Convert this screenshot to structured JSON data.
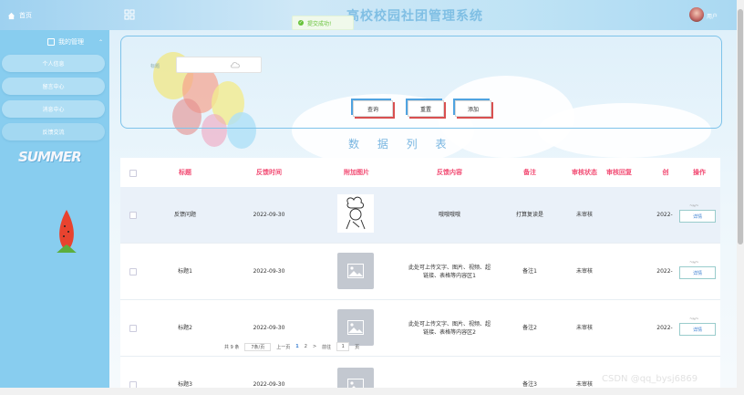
{
  "topbar": {
    "home_label": "首页",
    "title": "高校校园社团管理系统",
    "toast": "提交成功!",
    "user_label": "用户"
  },
  "sidebar": {
    "group_label": "我的管理",
    "items": [
      {
        "label": "个人信息"
      },
      {
        "label": "留言中心"
      },
      {
        "label": "消息中心"
      },
      {
        "label": "反馈交流"
      }
    ],
    "banner_text": "SUMMER"
  },
  "search": {
    "field_label": "标题",
    "field_value": "",
    "buttons": {
      "query": "查询",
      "reset": "重置",
      "add": "添加"
    }
  },
  "section_title": "数 据 列 表",
  "table": {
    "columns": [
      "标题",
      "反馈时间",
      "附加图片",
      "反馈内容",
      "备注",
      "审核状态",
      "审核回复",
      "创",
      "操作"
    ],
    "rows": [
      {
        "title": "反馈问题",
        "time": "2022-09-30",
        "content": "哦哦哦哦",
        "remark": "打算复读是",
        "status": "未审核",
        "created": "2022-",
        "action": "详情"
      },
      {
        "title": "标题1",
        "time": "2022-09-30",
        "content": "此处可上传文字、图片、视频、超链接、表格等内容区1",
        "remark": "备注1",
        "status": "未审核",
        "created": "2022-",
        "action": "详情"
      },
      {
        "title": "标题2",
        "time": "2022-09-30",
        "content": "此处可上传文字、图片、视频、超链接、表格等内容区2",
        "remark": "备注2",
        "status": "未审核",
        "created": "2022-",
        "action": "详情"
      },
      {
        "title": "标题3",
        "time": "2022-09-30",
        "content": "",
        "remark": "备注3",
        "status": "未审核",
        "created": "2022-",
        "action": "详情"
      }
    ]
  },
  "pager": {
    "total": "共 9 条",
    "page_size": "7条/页",
    "prev": "上一页",
    "pages": [
      "1",
      "2"
    ],
    "next": ">",
    "goto": "前往",
    "goto_value": "1",
    "page_unit": "页"
  },
  "watermark": "CSDN @qq_bysj6869"
}
